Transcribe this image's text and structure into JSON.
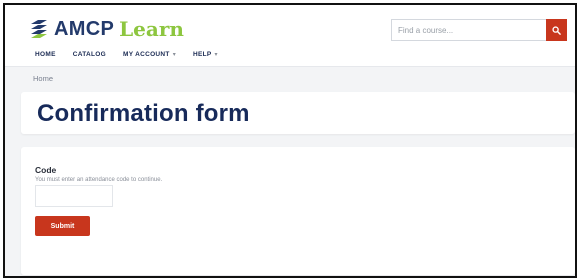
{
  "brand": {
    "name_primary": "AMCP",
    "name_secondary": "Learn",
    "colors": {
      "navy": "#233a6b",
      "green": "#8dc63f",
      "accent": "#c8361d"
    }
  },
  "search": {
    "placeholder": "Find a course...",
    "value": "",
    "icon": "search-icon"
  },
  "nav": {
    "items": [
      {
        "label": "HOME",
        "has_dropdown": false
      },
      {
        "label": "CATALOG",
        "has_dropdown": false
      },
      {
        "label": "MY ACCOUNT",
        "has_dropdown": true
      },
      {
        "label": "HELP",
        "has_dropdown": true
      }
    ]
  },
  "breadcrumb": {
    "home_label": "Home"
  },
  "page": {
    "title": "Confirmation form"
  },
  "form": {
    "code_label": "Code",
    "code_hint": "You must enter an attendance code to continue.",
    "code_value": "",
    "submit_label": "Submit"
  }
}
